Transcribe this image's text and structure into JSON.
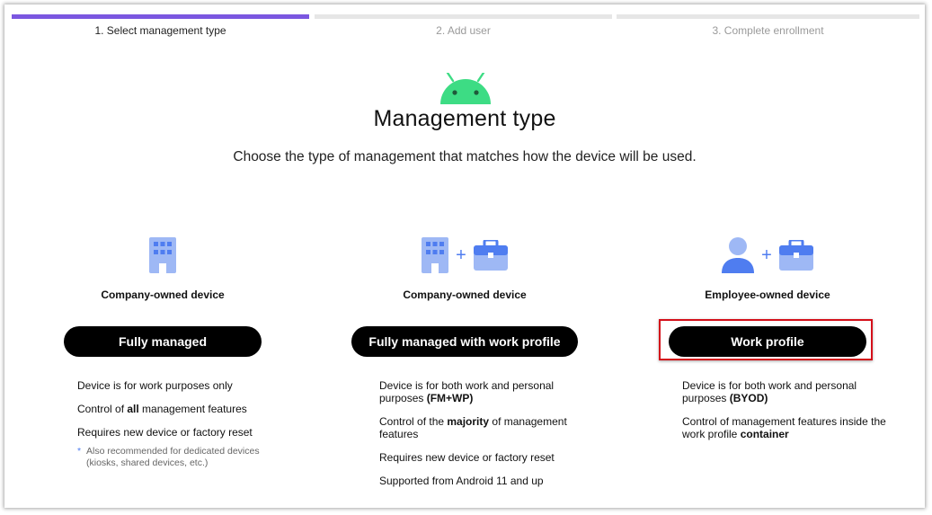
{
  "steps": [
    {
      "label": "1. Select management type",
      "active": true
    },
    {
      "label": "2. Add user",
      "active": false
    },
    {
      "label": "3. Complete enrollment",
      "active": false
    }
  ],
  "header": {
    "title": "Management type",
    "subtitle": "Choose the type of management that matches how the device will be used."
  },
  "icons": {
    "platform": "android-icon",
    "building": "building-icon",
    "briefcase": "briefcase-icon",
    "person": "person-icon",
    "plus": "+"
  },
  "colors": {
    "accent": "#7b57e0",
    "icon_blue": "#4f7df0",
    "android_green": "#3ddc84",
    "highlight_red": "#d40f1a"
  },
  "options": [
    {
      "owner": "Company-owned device",
      "button": "Fully managed",
      "desc": [
        [
          {
            "t": "Device is for work purposes only"
          }
        ],
        [
          {
            "t": "Control of "
          },
          {
            "t": "all",
            "b": true
          },
          {
            "t": " management features"
          }
        ],
        [
          {
            "t": "Requires new device or factory reset"
          }
        ]
      ],
      "note": "Also recommended for dedicated devices (kiosks, shared devices, etc.)",
      "note_mark": "*"
    },
    {
      "owner": "Company-owned device",
      "button": "Fully managed with work profile",
      "desc": [
        [
          {
            "t": "Device is for both work and personal purposes "
          },
          {
            "t": "(FM+WP)",
            "b": true
          }
        ],
        [
          {
            "t": "Control of the "
          },
          {
            "t": "majority",
            "b": true
          },
          {
            "t": " of management features"
          }
        ],
        [
          {
            "t": "Requires new device or factory reset"
          }
        ],
        [
          {
            "t": "Supported from Android 11 and up"
          }
        ]
      ]
    },
    {
      "owner": "Employee-owned device",
      "button": "Work profile",
      "desc": [
        [
          {
            "t": "Device is for both work and personal purposes "
          },
          {
            "t": "(BYOD)",
            "b": true
          }
        ],
        [
          {
            "t": "Control of management features inside the work profile "
          },
          {
            "t": "container",
            "b": true
          }
        ]
      ]
    }
  ]
}
